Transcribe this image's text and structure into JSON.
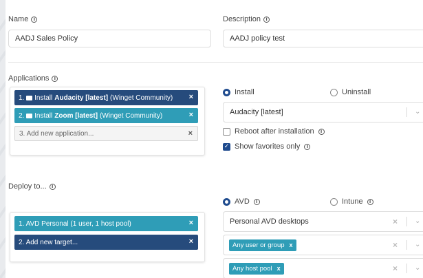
{
  "name": {
    "label": "Name",
    "value": "AADJ Sales Policy"
  },
  "description": {
    "label": "Description",
    "value": "AADJ policy test"
  },
  "applications": {
    "label": "Applications",
    "items": [
      {
        "index": "1.",
        "prefix": "Install",
        "bold": "Audacity [latest]",
        "suffix": "(Winget Community)"
      },
      {
        "index": "2.",
        "prefix": "Install",
        "bold": "Zoom [latest]",
        "suffix": "(Winget Community)"
      }
    ],
    "new_item": "3. Add new application...",
    "remove": "×"
  },
  "install_options": {
    "install": "Install",
    "uninstall": "Uninstall",
    "selected_app": "Audacity [latest]",
    "reboot_label": "Reboot after installation",
    "favorites_label": "Show favorites only"
  },
  "deploy": {
    "label": "Deploy to...",
    "items": [
      "1. AVD Personal (1 user, 1 host pool)"
    ],
    "new_item": "2. Add new target...",
    "remove": "×"
  },
  "target_options": {
    "avd": "AVD",
    "intune": "Intune",
    "desktop_select": "Personal AVD desktops",
    "user_chip": "Any user or group",
    "hostpool_chip": "Any host pool"
  },
  "icons": {
    "info": "info-icon",
    "chevron": "chevron-down-icon",
    "clear": "clear-icon",
    "folder": "folder-icon",
    "check": "check-icon"
  },
  "colors": {
    "dark_blue": "#264b7c",
    "teal": "#2f9db7",
    "radio_blue": "#1f4b8e"
  }
}
